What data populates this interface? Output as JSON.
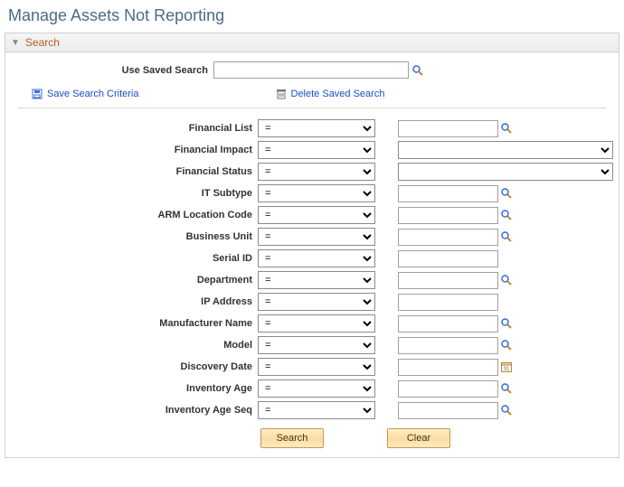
{
  "page_title": "Manage Assets Not Reporting",
  "panel": {
    "title": "Search",
    "saved_search_label": "Use Saved Search",
    "saved_search_value": "",
    "save_link": "Save Search Criteria",
    "delete_link": "Delete Saved Search"
  },
  "criteria": [
    {
      "label": "Financial List",
      "op": "=",
      "value": "",
      "type": "lookup"
    },
    {
      "label": "Financial Impact",
      "op": "=",
      "value": "",
      "type": "select"
    },
    {
      "label": "Financial Status",
      "op": "=",
      "value": "",
      "type": "select"
    },
    {
      "label": "IT Subtype",
      "op": "=",
      "value": "",
      "type": "lookup"
    },
    {
      "label": "ARM Location Code",
      "op": "=",
      "value": "",
      "type": "lookup"
    },
    {
      "label": "Business Unit",
      "op": "=",
      "value": "",
      "type": "lookup"
    },
    {
      "label": "Serial ID",
      "op": "=",
      "value": "",
      "type": "text"
    },
    {
      "label": "Department",
      "op": "=",
      "value": "",
      "type": "lookup"
    },
    {
      "label": "IP Address",
      "op": "=",
      "value": "",
      "type": "text"
    },
    {
      "label": "Manufacturer Name",
      "op": "=",
      "value": "",
      "type": "lookup"
    },
    {
      "label": "Model",
      "op": "=",
      "value": "",
      "type": "lookup"
    },
    {
      "label": "Discovery Date",
      "op": "=",
      "value": "",
      "type": "date"
    },
    {
      "label": "Inventory Age",
      "op": "=",
      "value": "",
      "type": "lookup"
    },
    {
      "label": "Inventory Age Seq",
      "op": "=",
      "value": "",
      "type": "lookup"
    }
  ],
  "buttons": {
    "search": "Search",
    "clear": "Clear"
  }
}
